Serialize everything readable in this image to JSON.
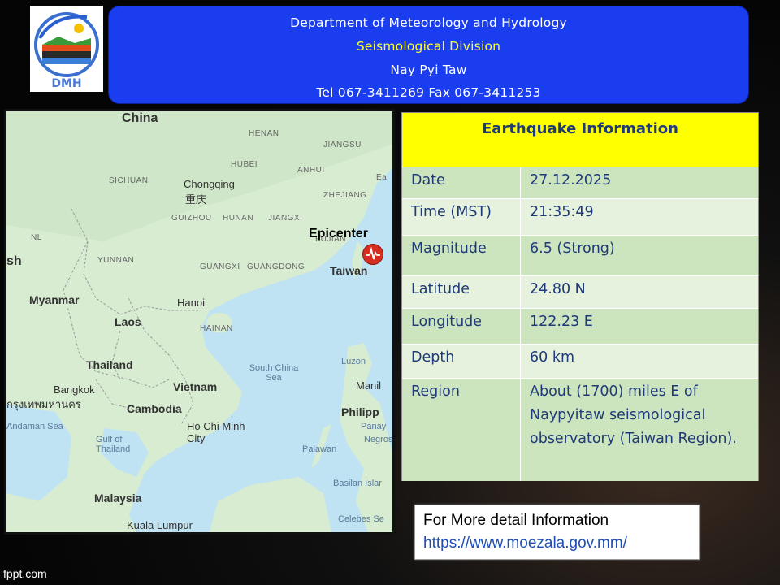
{
  "header": {
    "line1": "Department of Meteorology and Hydrology",
    "line2": "Seismological Division",
    "line3": "Nay Pyi Taw",
    "line4": "Tel 067-3411269 Fax 067-3411253",
    "logo_text": "DMH"
  },
  "map": {
    "epicenter_label": "Epicenter",
    "labels": {
      "china": "China",
      "henan": "HENAN",
      "jiangsu": "JIANGSU",
      "hubei": "HUBEI",
      "anhui": "ANHUI",
      "sichuan": "SICHUAN",
      "chongqing": "Chongqing",
      "chongqing_cn": "重庆",
      "zhejiang": "ZHEJIANG",
      "guizhou": "GUIZHOU",
      "hunan": "HUNAN",
      "jiangxi": "JIANGXI",
      "fujian": "FUJIAN",
      "yunnan": "YUNNAN",
      "guangxi": "GUANGXI",
      "guangdong": "GUANGDONG",
      "taiwan": "Taiwan",
      "myanmar": "Myanmar",
      "hanoi": "Hanoi",
      "laos": "Laos",
      "hainan": "HAINAN",
      "thailand": "Thailand",
      "south_china_sea": "South China Sea",
      "luzon": "Luzon",
      "bangkok": "Bangkok",
      "bangkok_th": "กรุงเทพมหานคร",
      "vietnam": "Vietnam",
      "manila": "Manil",
      "cambodia": "Cambodia",
      "andaman": "Andaman Sea",
      "philippines": "Philipp",
      "panay": "Panay",
      "hcm": "Ho Chi Minh City",
      "negros": "Negros",
      "gulf": "Gulf of Thailand",
      "palawan": "Palawan",
      "basilan": "Basilan Islar",
      "malaysia": "Malaysia",
      "kl": "Kuala Lumpur",
      "celebes": "Celebes Se",
      "nl": "NL",
      "sh": "sh",
      "ea": "Ea"
    }
  },
  "info": {
    "title": "Earthquake Information",
    "rows": [
      {
        "key": "Date",
        "value": "27.12.2025"
      },
      {
        "key": "Time (MST)",
        "value": "21:35:49"
      },
      {
        "key": "Magnitude",
        "value": "6.5 (Strong)"
      },
      {
        "key": "Latitude",
        "value": "24.80 N"
      },
      {
        "key": "Longitude",
        "value": "122.23 E"
      },
      {
        "key": "Depth",
        "value": "60 km"
      },
      {
        "key": "Region",
        "value": "About (1700) miles E of Naypyitaw seismological observatory (Taiwan Region)."
      }
    ]
  },
  "note": {
    "line1": "For More detail Information",
    "line2": "https://www.moezala.gov.mm/"
  },
  "footer": "fppt.com",
  "colors": {
    "header_bg": "#1b3df0",
    "title_bg": "#ffff00",
    "table_bg": "#a9d28f",
    "epicenter": "#d62d20"
  }
}
